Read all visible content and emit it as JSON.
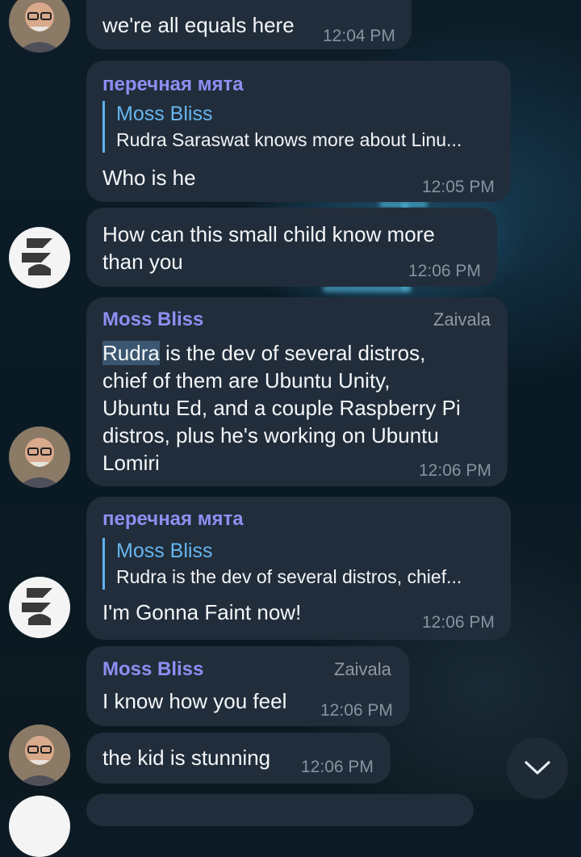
{
  "messages": [
    {
      "text": "we're all equals here",
      "time": "12:04 PM"
    },
    {
      "sender": "перечная мята",
      "reply_to": {
        "name": "Moss Bliss",
        "text": "Rudra Saraswat knows more about Linu..."
      },
      "text": "Who is he",
      "time": "12:05 PM"
    },
    {
      "text_lines": [
        "How can this small child know more",
        "than you"
      ],
      "time": "12:06 PM"
    },
    {
      "sender": "Moss Bliss",
      "role": "Zaivala",
      "highlight": "Rudra",
      "text_lines": [
        " is the dev of several distros,",
        "chief of them are Ubuntu Unity,",
        "Ubuntu Ed, and a couple Raspberry Pi",
        "distros, plus he's working on Ubuntu",
        "Lomiri"
      ],
      "time": "12:06 PM"
    },
    {
      "sender": "перечная мята",
      "reply_to": {
        "name": "Moss Bliss",
        "text": "Rudra is the dev of several distros, chief..."
      },
      "text": "I'm Gonna Faint now!",
      "time": "12:06 PM"
    },
    {
      "sender": "Moss Bliss",
      "role": "Zaivala",
      "text": "I know how you feel",
      "time": "12:06 PM"
    },
    {
      "text": "the kid is stunning",
      "time": "12:06 PM"
    }
  ],
  "avatars": {
    "moss": "user-avatar-photo",
    "peppermint": "user-avatar-logo"
  },
  "icons": {
    "scroll": "chevron-down-icon"
  },
  "colors": {
    "bubble": "#212d3b",
    "sender": "#8f8ef2",
    "reply_accent": "#5fb2ec",
    "time": "#8694a1"
  }
}
